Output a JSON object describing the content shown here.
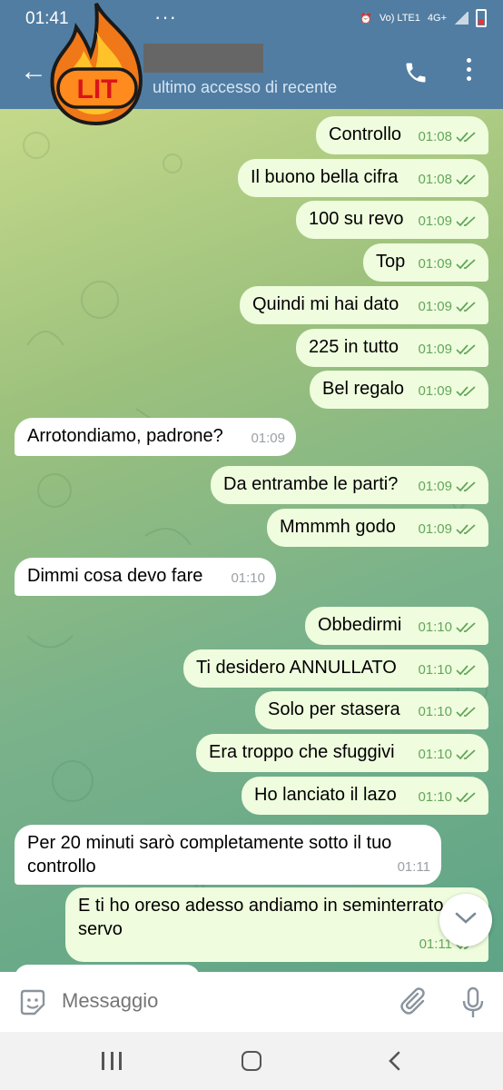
{
  "status_bar": {
    "time": "01:41",
    "network": "Vo) LTE1",
    "network_type": "4G+"
  },
  "header": {
    "subtitle": "ultimo accesso di recente"
  },
  "sticker": {
    "text": "LIT"
  },
  "messages": [
    {
      "dir": "out",
      "text": "Controllo",
      "time": "01:08"
    },
    {
      "dir": "out",
      "text": "Il buono bella cifra",
      "time": "01:08"
    },
    {
      "dir": "out",
      "text": "100 su revo",
      "time": "01:09"
    },
    {
      "dir": "out",
      "text": "Top",
      "time": "01:09"
    },
    {
      "dir": "out",
      "text": "Quindi mi hai dato",
      "time": "01:09"
    },
    {
      "dir": "out",
      "text": "225 in tutto",
      "time": "01:09"
    },
    {
      "dir": "out",
      "text": "Bel regalo",
      "time": "01:09"
    },
    {
      "dir": "in",
      "text": "Arrotondiamo, padrone?",
      "time": "01:09"
    },
    {
      "dir": "out",
      "text": "Da entrambe le parti?",
      "time": "01:09"
    },
    {
      "dir": "out",
      "text": "Mmmmh godo",
      "time": "01:09"
    },
    {
      "dir": "in",
      "text": "Dimmi cosa devo fare",
      "time": "01:10"
    },
    {
      "dir": "out",
      "text": "Obbedirmi",
      "time": "01:10"
    },
    {
      "dir": "out",
      "text": "Ti desidero ANNULLATO",
      "time": "01:10"
    },
    {
      "dir": "out",
      "text": "Solo per stasera",
      "time": "01:10"
    },
    {
      "dir": "out",
      "text": "Era troppo che sfuggivi",
      "time": "01:10"
    },
    {
      "dir": "out",
      "text": "Ho lanciato il lazo",
      "time": "01:10"
    },
    {
      "dir": "in",
      "text": "Per 20 minuti sarò completamente sotto il tuo",
      "text2": "controllo",
      "time": "01:11"
    },
    {
      "dir": "out",
      "text": "E ti ho oreso adesso andiamo in seminterrato",
      "text2": "servo",
      "time": "01:11"
    }
  ],
  "input": {
    "placeholder": "Messaggio"
  },
  "colors": {
    "header": "#517da2",
    "bubble_out": "#effdde",
    "bubble_in": "#ffffff",
    "tick": "#64a65b"
  }
}
